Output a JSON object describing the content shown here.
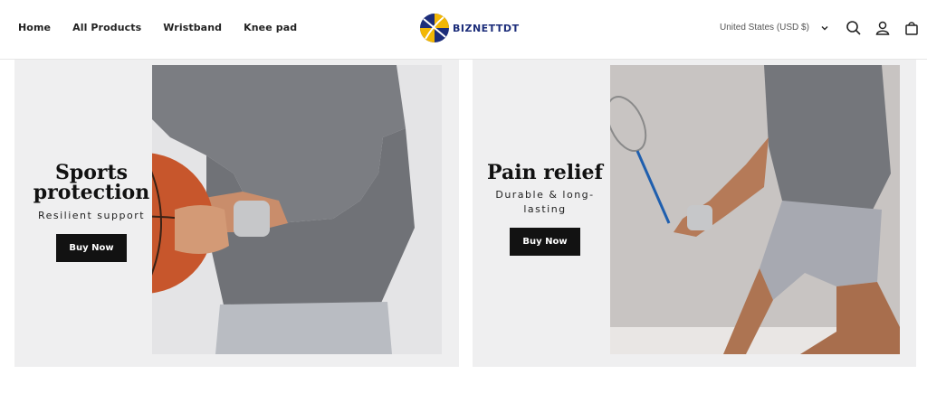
{
  "header": {
    "nav": [
      {
        "label": "Home"
      },
      {
        "label": "All Products"
      },
      {
        "label": "Wristband"
      },
      {
        "label": "Knee pad"
      }
    ],
    "logo_text": "BIZNETTDT",
    "locale": "United States (USD $)",
    "icons": [
      "search-icon",
      "account-icon",
      "cart-icon"
    ]
  },
  "banners": [
    {
      "headline_line1": "Sports",
      "headline_line2": "protection",
      "subtitle": "Resilient support",
      "button": "Buy Now"
    },
    {
      "headline_line1": "Pain relief",
      "subtitle": "Durable & long-lasting",
      "button": "Buy Now"
    }
  ],
  "colors": {
    "brand_blue": "#1c2d7a",
    "brand_yellow": "#f2b705",
    "button": "#121212",
    "card_bg": "#efeff0"
  }
}
